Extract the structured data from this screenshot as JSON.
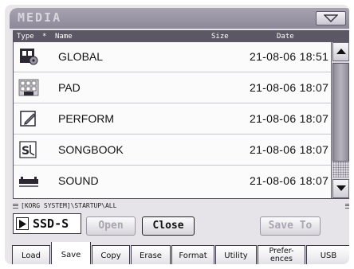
{
  "window": {
    "title": "MEDIA"
  },
  "list": {
    "columns": {
      "type": "Type",
      "sort_marker": "*",
      "name": "Name",
      "size": "Size",
      "date": "Date"
    },
    "rows": [
      {
        "icon": "global-icon",
        "name": "GLOBAL",
        "date": "21-08-06 18:51"
      },
      {
        "icon": "pad-icon",
        "name": "PAD",
        "date": "21-08-06 18:07"
      },
      {
        "icon": "perform-icon",
        "name": "PERFORM",
        "date": "21-08-06 18:07"
      },
      {
        "icon": "songbook-icon",
        "name": "SONGBOOK",
        "date": "21-08-06 18:07"
      },
      {
        "icon": "sound-icon",
        "name": "SOUND",
        "date": "21-08-06 18:07"
      }
    ]
  },
  "path": "[KORG SYSTEM]\\STARTUP\\ALL",
  "device": {
    "label": "SSD-S"
  },
  "buttons": {
    "open": "Open",
    "close": "Close",
    "save_to": "Save To"
  },
  "tabs": [
    "Load",
    "Save",
    "Copy",
    "Erase",
    "Format",
    "Utility",
    "Prefer-\nences",
    "USB"
  ],
  "selected_tab": "Save",
  "colors": {
    "title_bar": "#8d8999",
    "list_header": "#5b5764",
    "background": "#e6e4e8"
  }
}
